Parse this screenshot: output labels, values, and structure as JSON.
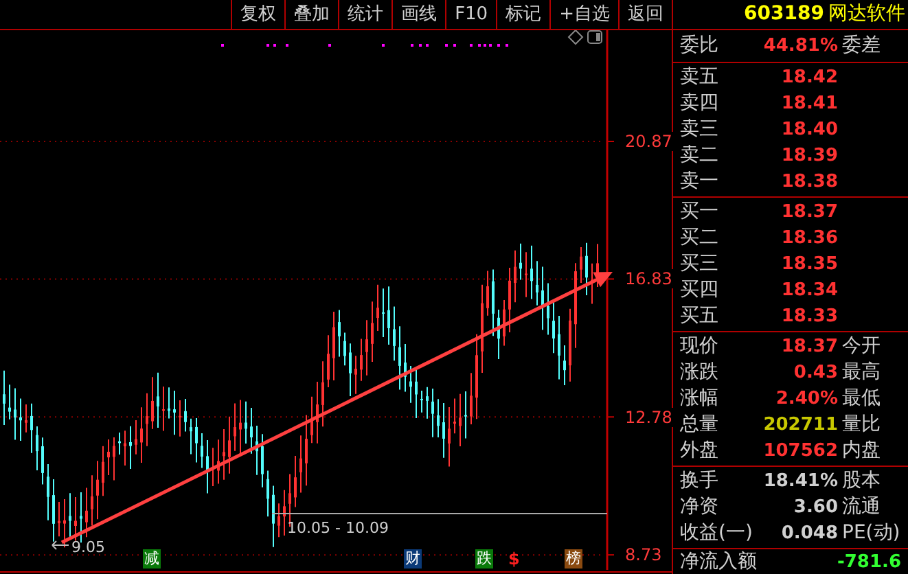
{
  "toolbar": {
    "buttons": [
      "复权",
      "叠加",
      "统计",
      "画线",
      "F10",
      "标记",
      "+自选",
      "返回"
    ]
  },
  "stock": {
    "code": "603189",
    "name": "网达软件"
  },
  "chart": {
    "y_axis_labels": [
      "20.87",
      "16.83",
      "12.78",
      "8.73"
    ],
    "range_label": "10.05 - 10.09",
    "low_label": "9.05",
    "event_markers": [
      {
        "text": "减",
        "kind": "badge",
        "color": "#0a7a0a"
      },
      {
        "text": "财",
        "kind": "badge",
        "color": "#0b3a78"
      },
      {
        "text": "跌",
        "kind": "badge",
        "color": "#0a7a0a"
      },
      {
        "text": "$",
        "kind": "symbol",
        "color": "#ff2020"
      },
      {
        "text": "榜",
        "kind": "badge",
        "color": "#8a4a10"
      }
    ]
  },
  "order_book": {
    "ratio": {
      "label": "委比",
      "value": "44.81%",
      "label_2": "委差"
    },
    "asks": [
      {
        "label": "卖五",
        "price": "18.42"
      },
      {
        "label": "卖四",
        "price": "18.41"
      },
      {
        "label": "卖三",
        "price": "18.40"
      },
      {
        "label": "卖二",
        "price": "18.39"
      },
      {
        "label": "卖一",
        "price": "18.38"
      }
    ],
    "bids": [
      {
        "label": "买一",
        "price": "18.37"
      },
      {
        "label": "买二",
        "price": "18.36"
      },
      {
        "label": "买三",
        "price": "18.35"
      },
      {
        "label": "买四",
        "price": "18.34"
      },
      {
        "label": "买五",
        "price": "18.33"
      }
    ]
  },
  "quote": [
    {
      "label": "现价",
      "value": "18.37",
      "label_2": "今开",
      "color": "#ff3232"
    },
    {
      "label": "涨跌",
      "value": "0.43",
      "label_2": "最高",
      "color": "#ff3232"
    },
    {
      "label": "涨幅",
      "value": "2.40%",
      "label_2": "最低",
      "color": "#ff3232"
    },
    {
      "label": "总量",
      "value": "202711",
      "label_2": "量比",
      "color": "#c8c800"
    },
    {
      "label": "外盘",
      "value": "107562",
      "label_2": "内盘",
      "color": "#ff3232"
    }
  ],
  "stats": [
    {
      "label": "换手",
      "value": "18.41%",
      "label_2": "股本"
    },
    {
      "label": "净资",
      "value": "3.60",
      "label_2": "流通"
    },
    {
      "label": "收益(一)",
      "value": "0.048",
      "label_2": "PE(动)"
    }
  ],
  "net_inflow": {
    "label": "净流入额",
    "value": "-781.6"
  }
}
